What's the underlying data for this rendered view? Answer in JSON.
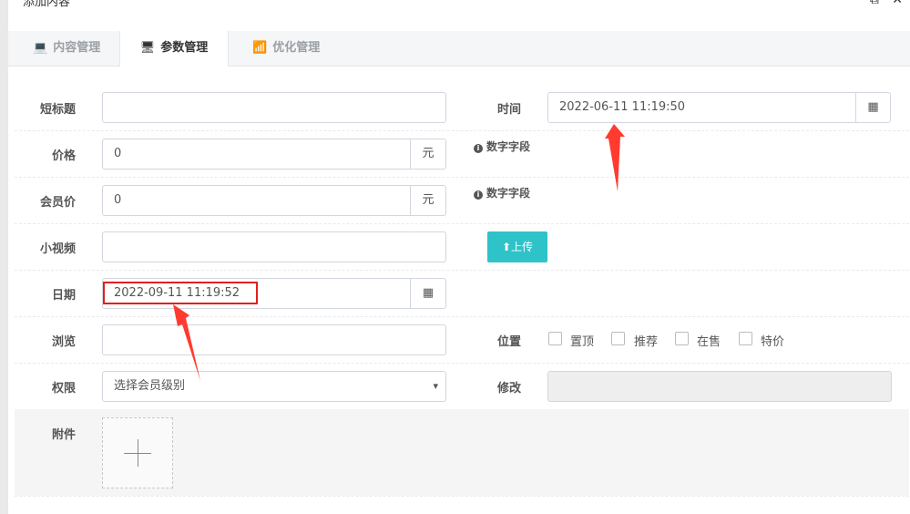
{
  "window": {
    "title": "添加内容"
  },
  "tabs": [
    {
      "label": "内容管理",
      "icon": "laptop-icon"
    },
    {
      "label": "参数管理",
      "icon": "monitor-icon"
    },
    {
      "label": "优化管理",
      "icon": "signal-icon"
    }
  ],
  "form": {
    "short_title": {
      "label": "短标题",
      "value": ""
    },
    "time": {
      "label": "时间",
      "value": "2022-06-11 11:19:50"
    },
    "price": {
      "label": "价格",
      "value": "0",
      "unit": "元",
      "hint": "数字字段"
    },
    "member_price": {
      "label": "会员价",
      "value": "0",
      "unit": "元",
      "hint": "数字字段"
    },
    "video": {
      "label": "小视频",
      "value": "",
      "upload_label": "上传"
    },
    "date": {
      "label": "日期",
      "value": "2022-09-11 11:19:52"
    },
    "views": {
      "label": "浏览",
      "value": ""
    },
    "position": {
      "label": "位置",
      "options": [
        "置顶",
        "推荐",
        "在售",
        "特价"
      ]
    },
    "permission": {
      "label": "权限",
      "selected": "选择会员级别"
    },
    "modify": {
      "label": "修改",
      "value": ""
    },
    "attachment": {
      "label": "附件"
    }
  },
  "colors": {
    "accent": "#2ec3c8",
    "highlight": "#e02020"
  }
}
